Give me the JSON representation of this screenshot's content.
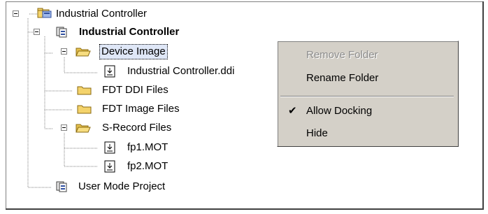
{
  "tree": {
    "root": {
      "label": "Industrial Controller",
      "icon": "project-folder-icon"
    },
    "project": {
      "label": "Industrial Controller",
      "icon": "project-icon"
    },
    "device_image": {
      "label": "Device Image",
      "icon": "folder-open-icon"
    },
    "ddi_file": {
      "label": "Industrial Controller.ddi",
      "icon": "download-file-icon"
    },
    "fdt_ddi": {
      "label": "FDT DDI Files",
      "icon": "folder-icon"
    },
    "fdt_image": {
      "label": "FDT Image Files",
      "icon": "folder-icon"
    },
    "srecord": {
      "label": "S-Record Files",
      "icon": "folder-open-icon"
    },
    "fp1": {
      "label": "fp1.MOT",
      "icon": "download-file-icon"
    },
    "fp2": {
      "label": "fp2.MOT",
      "icon": "download-file-icon"
    },
    "user_mode": {
      "label": "User Mode Project",
      "icon": "project-icon"
    }
  },
  "context_menu": {
    "remove_folder": {
      "label": "Remove Folder",
      "enabled": false
    },
    "rename_folder": {
      "label": "Rename Folder",
      "enabled": true
    },
    "allow_docking": {
      "label": "Allow Docking",
      "checked": true,
      "check_glyph": "✔"
    },
    "hide": {
      "label": "Hide",
      "enabled": true
    }
  },
  "colors": {
    "folder": "#f4d36b",
    "folder_dark": "#b08a1a",
    "menu_bg": "#d4d0c8",
    "selection": "#dfe7f7"
  }
}
